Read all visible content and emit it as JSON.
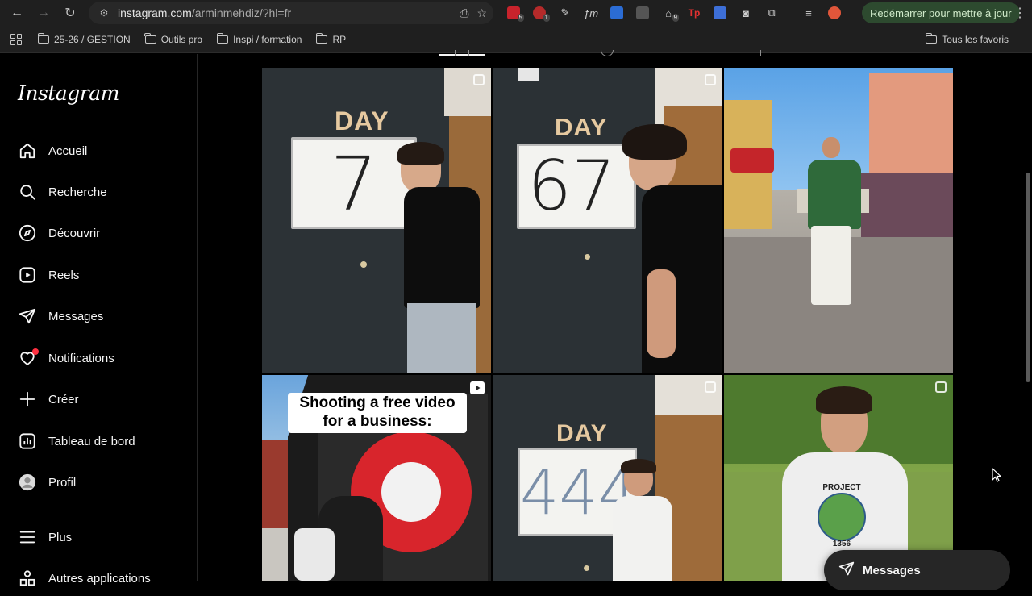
{
  "browser": {
    "url_host": "instagram.com",
    "url_path": "/arminmehdiz/?hl=fr",
    "restart_label": "Redémarrer pour mettre à jour",
    "extension_badges": [
      "5",
      "1",
      "9"
    ],
    "bookmarks": [
      "25-26 / GESTION",
      "Outils pro",
      "Inspi / formation",
      "RP"
    ],
    "bookmarks_right": "Tous les favoris"
  },
  "sidebar": {
    "logo": "Instagram",
    "items": [
      {
        "label": "Accueil",
        "icon": "home-icon"
      },
      {
        "label": "Recherche",
        "icon": "search-icon"
      },
      {
        "label": "Découvrir",
        "icon": "compass-icon"
      },
      {
        "label": "Reels",
        "icon": "reels-icon"
      },
      {
        "label": "Messages",
        "icon": "send-icon"
      },
      {
        "label": "Notifications",
        "icon": "heart-icon"
      },
      {
        "label": "Créer",
        "icon": "plus-icon"
      },
      {
        "label": "Tableau de bord",
        "icon": "dashboard-icon"
      },
      {
        "label": "Profil",
        "icon": "avatar-icon"
      },
      {
        "label": "Plus",
        "icon": "menu-icon"
      },
      {
        "label": "Autres applications",
        "icon": "apps-icon"
      }
    ]
  },
  "posts": [
    {
      "day_label": "DAY",
      "board_value": "7"
    },
    {
      "day_label": "DAY",
      "board_value": "67"
    },
    {
      "day_label": "",
      "board_value": ""
    },
    {
      "caption": "Shooting a free video for a business:"
    },
    {
      "day_label": "DAY",
      "board_value": "444"
    },
    {
      "day_label": "",
      "board_value": "",
      "hoodie_text": "PROJECT",
      "hoodie_number": "1356"
    }
  ],
  "messages_pill": {
    "label": "Messages"
  }
}
